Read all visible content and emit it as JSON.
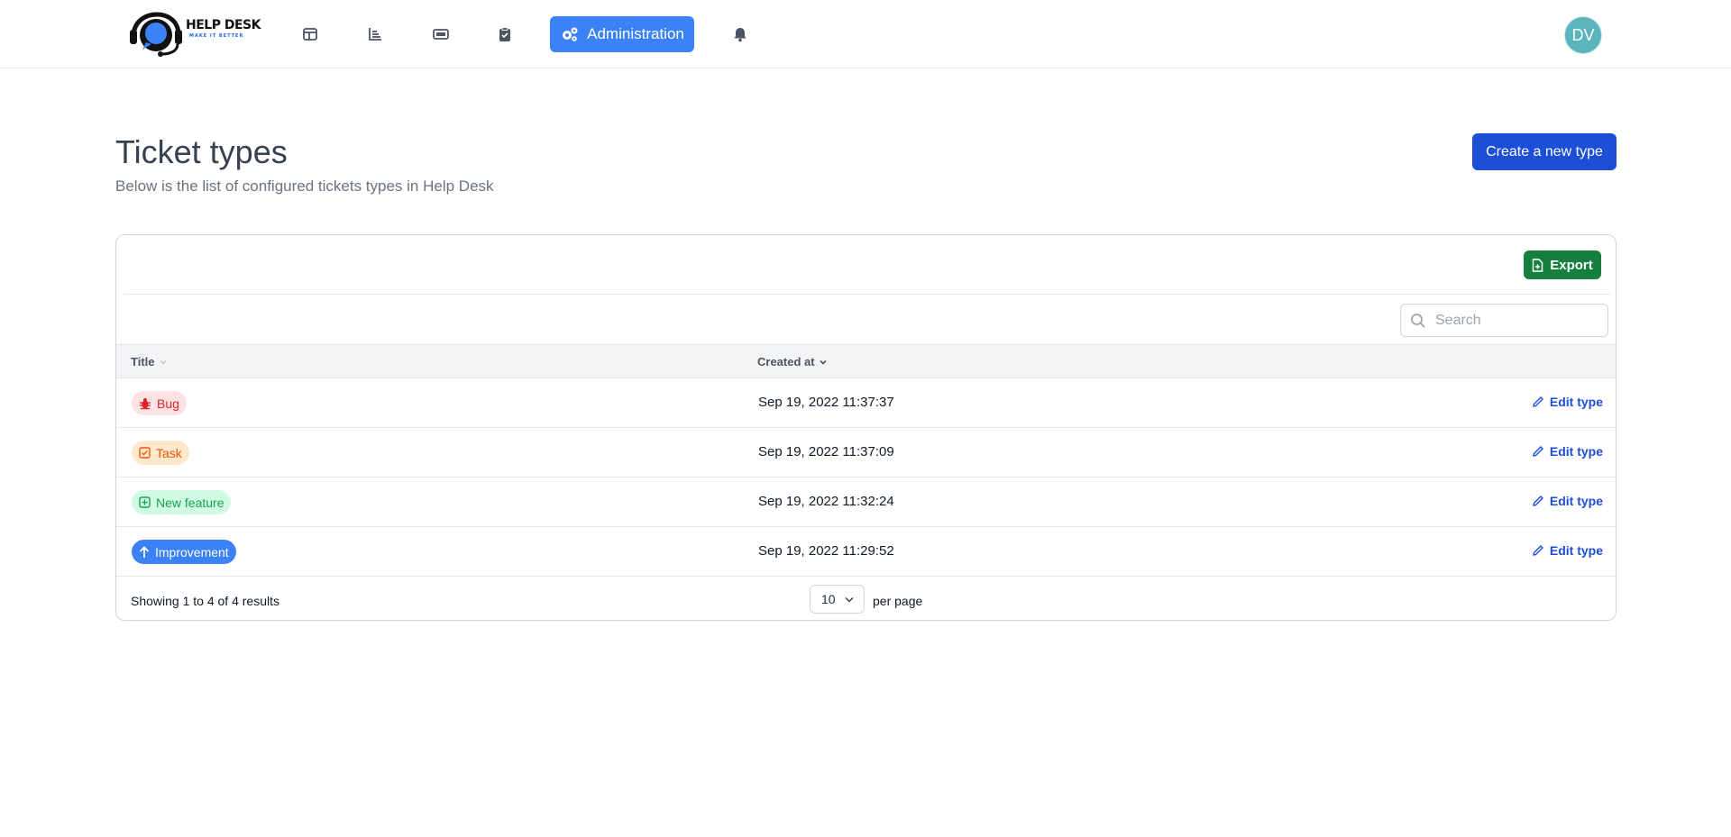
{
  "header": {
    "logo_text": "HELP DESK",
    "logo_tagline": "MAKE IT BETTER",
    "admin_label": "Administration",
    "avatar_initials": "DV"
  },
  "page": {
    "title": "Ticket types",
    "subtitle": "Below is the list of configured tickets types in Help Desk",
    "create_label": "Create a new type"
  },
  "table": {
    "export_label": "Export",
    "search_placeholder": "Search",
    "columns": {
      "title": "Title",
      "created_at": "Created at"
    },
    "rows": [
      {
        "title": "Bug",
        "icon": "bug-icon",
        "created_at": "Sep 19, 2022 11:37:37",
        "action": "Edit type",
        "colors": {
          "bg": "#fde2e4",
          "fg": "#dc2626"
        }
      },
      {
        "title": "Task",
        "icon": "checkbox-icon",
        "created_at": "Sep 19, 2022 11:37:09",
        "action": "Edit type",
        "colors": {
          "bg": "#ffe8cc",
          "fg": "#ea580c"
        }
      },
      {
        "title": "New feature",
        "icon": "plus-square-icon",
        "created_at": "Sep 19, 2022 11:32:24",
        "action": "Edit type",
        "colors": {
          "bg": "#d1fae5",
          "fg": "#16a34a"
        }
      },
      {
        "title": "Improvement",
        "icon": "arrow-up-icon",
        "created_at": "Sep 19, 2022 11:29:52",
        "action": "Edit type",
        "colors": {
          "bg": "#3b82f6",
          "fg": "#ffffff"
        }
      }
    ],
    "footer": {
      "showing": "Showing 1 to 4 of 4 results",
      "per_page_value": "10",
      "per_page_label": "per page"
    }
  }
}
